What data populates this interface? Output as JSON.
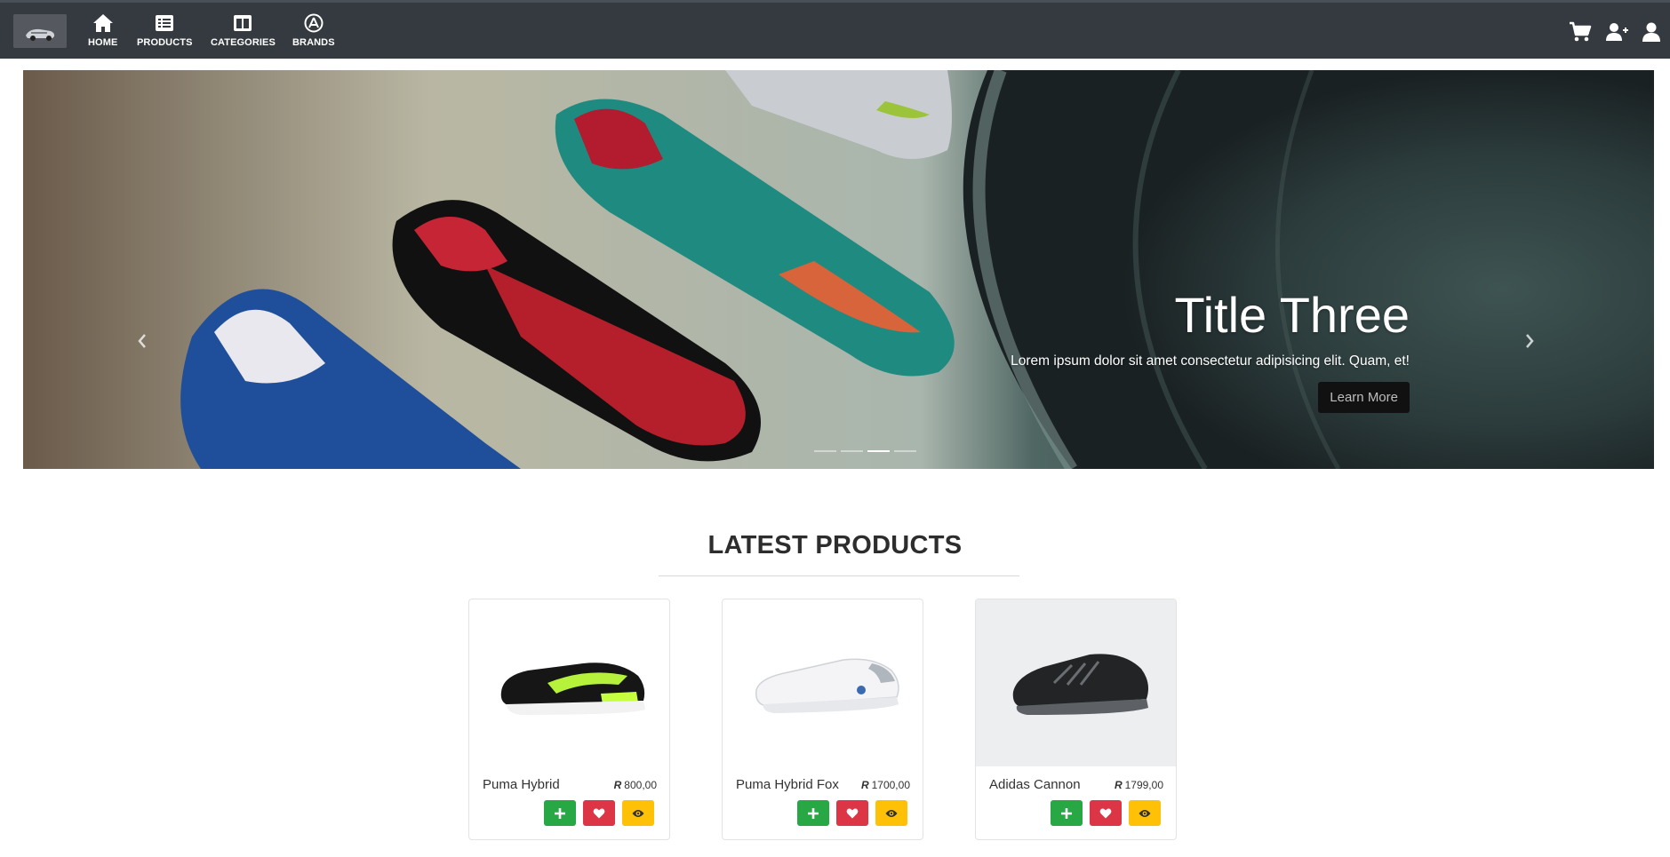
{
  "navbar": {
    "items": [
      {
        "label": "HOME",
        "icon": "home-icon"
      },
      {
        "label": "PRODUCTS",
        "icon": "list-icon"
      },
      {
        "label": "CATEGORIES",
        "icon": "columns-icon"
      },
      {
        "label": "BRANDS",
        "icon": "app-store-icon"
      }
    ],
    "right_icons": [
      "cart-icon",
      "user-plus-icon",
      "user-icon"
    ]
  },
  "carousel": {
    "title": "Title Three",
    "text": "Lorem ipsum dolor sit amet consectetur adipisicing elit. Quam, et!",
    "button_label": "Learn More",
    "slide_count": 4,
    "active_slide": 3
  },
  "section": {
    "title": "LATEST PRODUCTS"
  },
  "products": [
    {
      "name": "Puma Hybrid",
      "currency": "R",
      "price": "800,00"
    },
    {
      "name": "Puma Hybrid Fox",
      "currency": "R",
      "price": "1700,00"
    },
    {
      "name": "Adidas Cannon",
      "currency": "R",
      "price": "1799,00"
    }
  ],
  "colors": {
    "navbar_bg": "#343a40",
    "add_button": "#28a745",
    "wishlist_button": "#dc3545",
    "view_button": "#ffc107"
  }
}
